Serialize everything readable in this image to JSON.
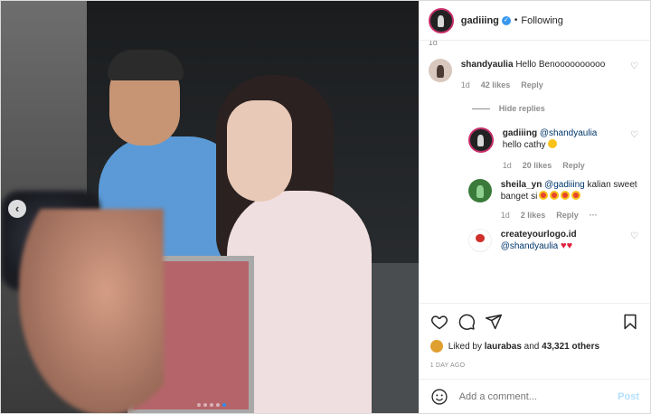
{
  "header": {
    "username": "gadiiing",
    "verified_icon": "verified-badge-icon",
    "separator": "•",
    "follow_status": "Following"
  },
  "comments": {
    "top_time": "1d",
    "items": [
      {
        "username": "shandyaulia",
        "text": "Hello Benoooooooooo",
        "time": "1d",
        "likes": "42 likes",
        "reply": "Reply"
      }
    ],
    "hide_replies": "Hide replies",
    "replies": [
      {
        "username": "gadiiing",
        "mention": "@shandyaulia",
        "text": "hello cathy",
        "time": "1d",
        "likes": "20 likes",
        "reply": "Reply"
      },
      {
        "username": "sheila_yn",
        "mention": "@gadiiing",
        "text": "kalian sweet banget si",
        "time": "1d",
        "likes": "2 likes",
        "reply": "Reply",
        "more": "···"
      },
      {
        "username": "createyourlogo.id",
        "mention": "@shandyaulia",
        "text": ""
      }
    ]
  },
  "likes": {
    "prefix": "Liked by ",
    "user": "laurabas",
    "middle": " and ",
    "count": "43,321 others"
  },
  "date": "1 DAY AGO",
  "add_comment": {
    "placeholder": "Add a comment...",
    "post_label": "Post"
  },
  "photo": {
    "nav_arrow": "‹"
  },
  "colors": {
    "accent": "#3897f0",
    "story_ring": "#c52f6a",
    "heart_red": "#e02040"
  }
}
